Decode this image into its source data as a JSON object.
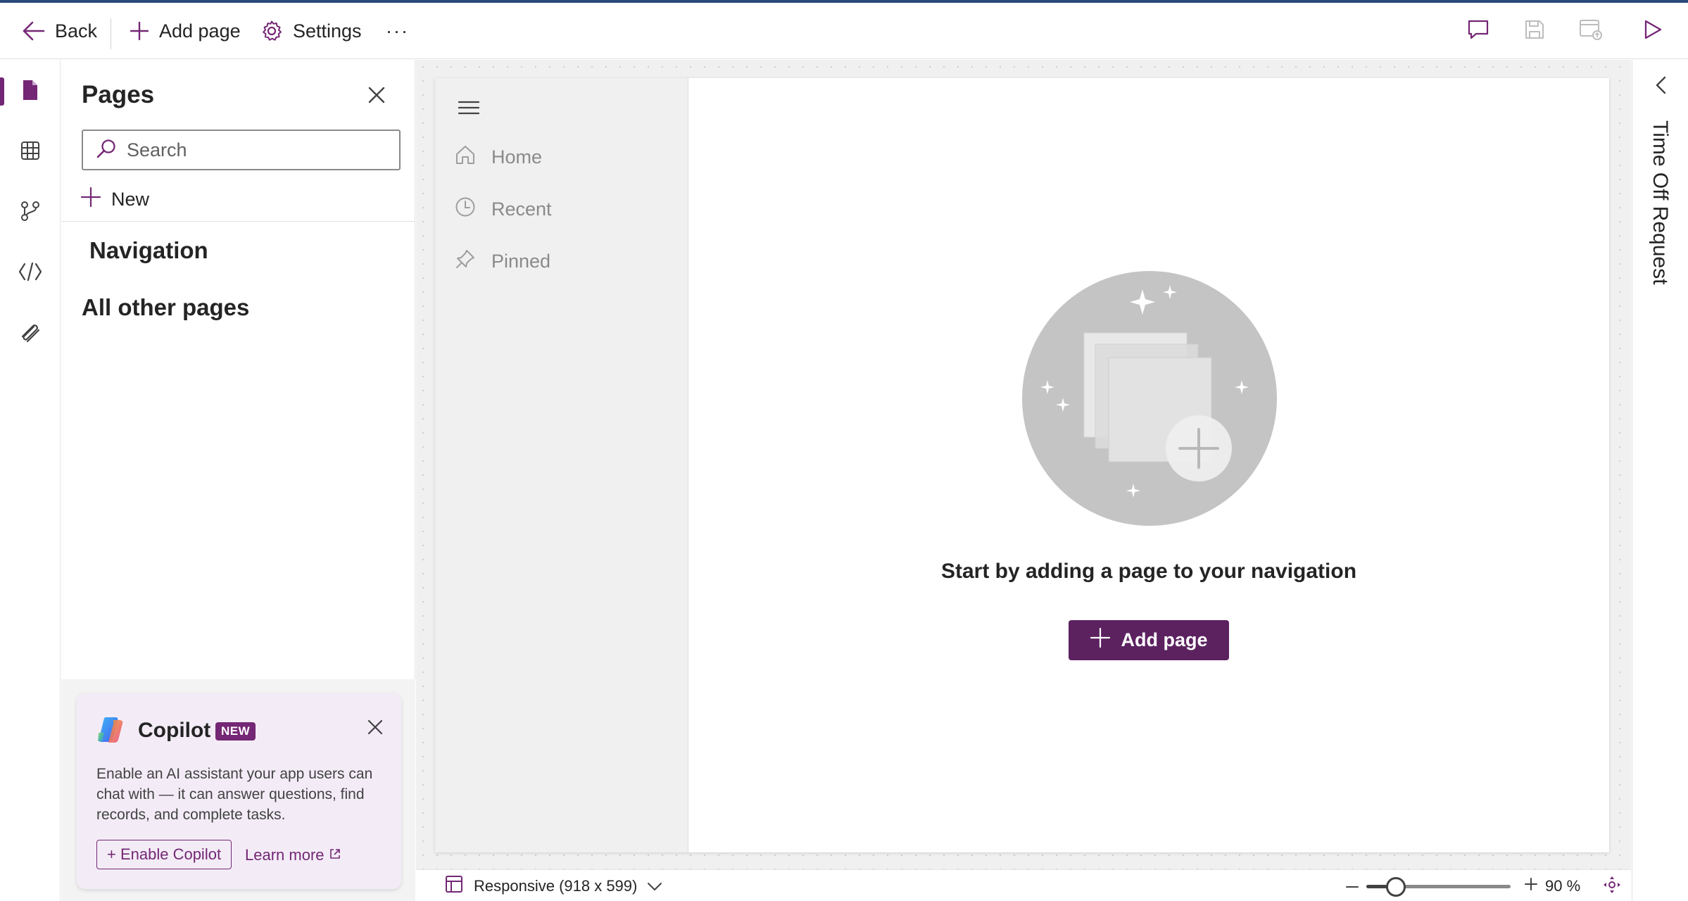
{
  "commandbar": {
    "back_label": "Back",
    "add_page_label": "Add page",
    "settings_label": "Settings",
    "more_label": "···"
  },
  "pages_panel": {
    "title": "Pages",
    "search_placeholder": "Search",
    "new_label": "New",
    "navigation_heading": "Navigation",
    "other_pages_heading": "All other pages"
  },
  "copilot": {
    "title": "Copilot",
    "badge": "NEW",
    "description": "Enable an AI assistant your app users can chat with — it can answer questions, find records, and complete tasks.",
    "enable_label": "+ Enable Copilot",
    "learn_more_label": "Learn more"
  },
  "app_preview": {
    "nav_items": [
      {
        "label": "Home",
        "icon": "home-icon"
      },
      {
        "label": "Recent",
        "icon": "clock-icon"
      },
      {
        "label": "Pinned",
        "icon": "pin-icon"
      }
    ],
    "empty_message": "Start by adding a page to your navigation",
    "add_page_label": "Add page"
  },
  "right_panel": {
    "title": "Time Off Request"
  },
  "statusbar": {
    "screen_size_label": "Responsive (918 x 599)",
    "zoom_value": 90,
    "zoom_label": "90 %"
  },
  "colors": {
    "accent": "#742774",
    "primary_button": "#5c2260",
    "top_line": "#2b4a7a"
  }
}
